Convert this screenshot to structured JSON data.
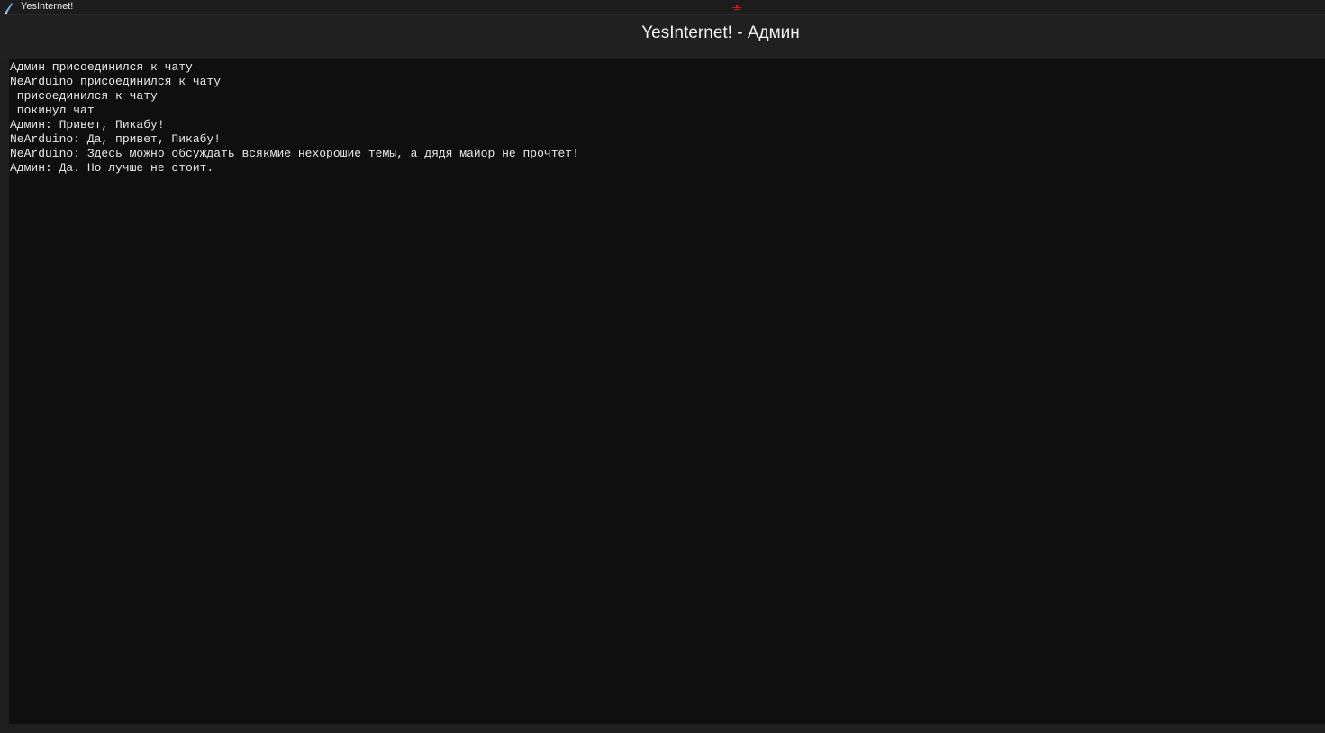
{
  "window": {
    "title": "YesInternet!",
    "icons": {
      "app": "feather-icon",
      "marker": "red-marker-icon"
    }
  },
  "header": {
    "title": "YesInternet! - Админ"
  },
  "chat": {
    "messages": [
      "Админ присоединился к чату",
      "NeArduino присоединился к чату",
      " присоединился к чату",
      " покинул чат",
      "Админ: Привет, Пикабу!",
      "NeArduino: Да, привет, Пикабу!",
      "NeArduino: Здесь можно обсуждать всякмие нехорошие темы, а дядя майор не прочтёт!",
      "Админ: Да. Но лучше не стоит."
    ]
  },
  "colors": {
    "background": "#1f1f1f",
    "chat_background": "#0f0f10",
    "text": "#e8e8e8",
    "marker": "#d01818"
  }
}
